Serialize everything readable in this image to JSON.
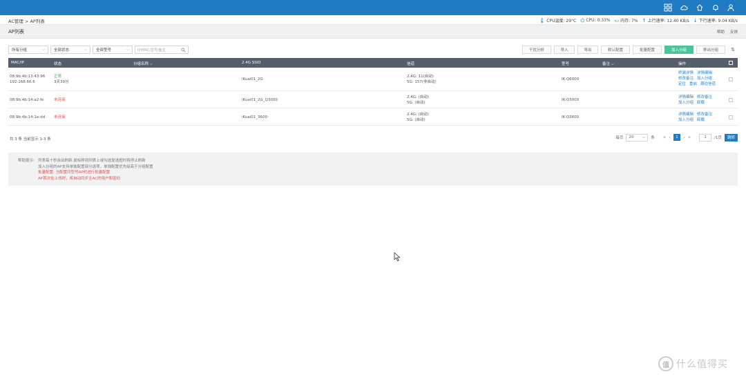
{
  "breadcrumb": "AC管理 > AP列表",
  "system": {
    "cpu_temp": "CPU温度: 29°C",
    "cpu": "CPU: 0.33%",
    "memory": "内存: 7%",
    "up": "上行速率: 12.40 KB/s",
    "down": "下行速率: 9.04 KB/s"
  },
  "page": {
    "title": "AP列表",
    "help": "帮助",
    "feedback": "反馈"
  },
  "filters": {
    "group": "所有分组",
    "status": "全部状态",
    "model": "全部型号",
    "search_placeholder": "IP/MAC/型号/备注"
  },
  "actions": {
    "interference": "干扰分析",
    "import": "导入",
    "export": "导出",
    "default_config": "默认配置",
    "batch_config": "批量配置",
    "add_group": "加入分组",
    "remove_group": "移出分组"
  },
  "table": {
    "headers": {
      "mac": "MAC/IP",
      "status": "状态",
      "group": "分组名称",
      "ssid": "2.4G SSID",
      "channel": "信道",
      "model": "型号",
      "remark": "备注",
      "ops": "操作"
    },
    "rows": [
      {
        "mac": "08:9b:4b:13:43:96",
        "ip": "192.168.66.6",
        "status": "正常",
        "uptime": "3天39分",
        "ssid": "iKuai01_2G",
        "ch24": "2.4G: 11(自动)",
        "ch5": "5G: 157(非自动)",
        "model": "IK-Q6000",
        "ops": [
          "终端详情",
          "详情编辑",
          "修改备注",
          "加入分组",
          "定位",
          "重启",
          "周边信道"
        ]
      },
      {
        "mac": "08:9b:4b:14:a2:fe",
        "ip": "",
        "status": "未连接",
        "uptime": "",
        "ssid": "iKuai01_2G_Q3000",
        "ch24": "2.4G: (自动)",
        "ch5": "5G: (自动)",
        "model": "IK-Q3000",
        "ops": [
          "详情编辑",
          "修改备注",
          "加入分组",
          "卸载"
        ]
      },
      {
        "mac": "08:9b:4b:14:1e:dd",
        "ip": "",
        "status": "未连接",
        "uptime": "",
        "ssid": "iKuai01_3600",
        "ch24": "2.4G: (自动)",
        "ch5": "5G: (自动)",
        "model": "IK-Q3600",
        "ops": [
          "详情编辑",
          "修改备注",
          "加入分组",
          "卸载"
        ]
      }
    ]
  },
  "footer": {
    "count": "共 3 条 当前显示 1-3 条",
    "per_page_label": "每页",
    "per_page": "20",
    "unit": "条",
    "current_page": "1",
    "page_input": "1",
    "total_pages": "/1页",
    "go": "跳转"
  },
  "tips": {
    "label": "帮助提示:",
    "lines": [
      "列表每十秒自动刷新,鼠标移到列表上或勾选复选框时将停止刷新",
      "加入分组的AP支持单独配置部分选项，单独配置优先级高于分组配置",
      "批量配置: 当配置同型号AP时进行批量配置",
      "AP首次在上线时，将自动同步主AC的用户和密码"
    ]
  },
  "watermark": {
    "text": "什么值得买",
    "logo": "值"
  },
  "colors": {
    "brand": "#1f7bc2",
    "header": "#565d6b",
    "ok": "#4aa85a",
    "error": "#e0544f",
    "link": "#2384d4",
    "primary_btn": "#4cc49b"
  }
}
